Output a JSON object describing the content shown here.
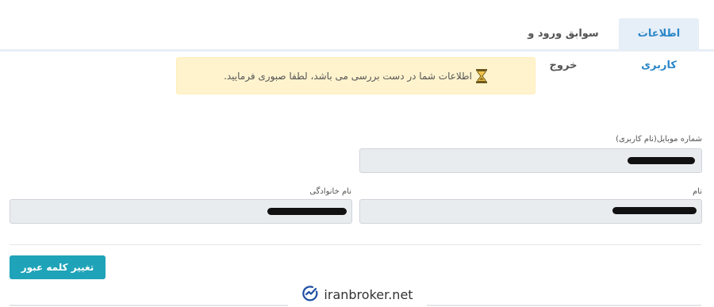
{
  "tabs": {
    "active_label": "اطلاعات کاربری",
    "inactive_label": "سوابق ورود و خروج"
  },
  "alert": {
    "text": "اطلاعات شما در دست بررسی می باشد، لطفا صبوری فرمایید.",
    "icon": "hourglass-icon"
  },
  "form": {
    "mobile_label": "شماره موبایل(نام کاربری)",
    "first_name_label": "نام",
    "last_name_label": "نام خانوادگی",
    "mobile_value": "",
    "first_name_value": "",
    "last_name_value": ""
  },
  "actions": {
    "change_password_label": "تغییر کلمه عبور"
  },
  "watermark": {
    "text": "iranbroker.net"
  },
  "colors": {
    "tab_active_bg": "#e6eef8",
    "tab_active_text": "#2a86c8",
    "alert_bg": "#fff3cd",
    "button_bg": "#1fa3b8",
    "field_bg": "#e9ecef"
  }
}
